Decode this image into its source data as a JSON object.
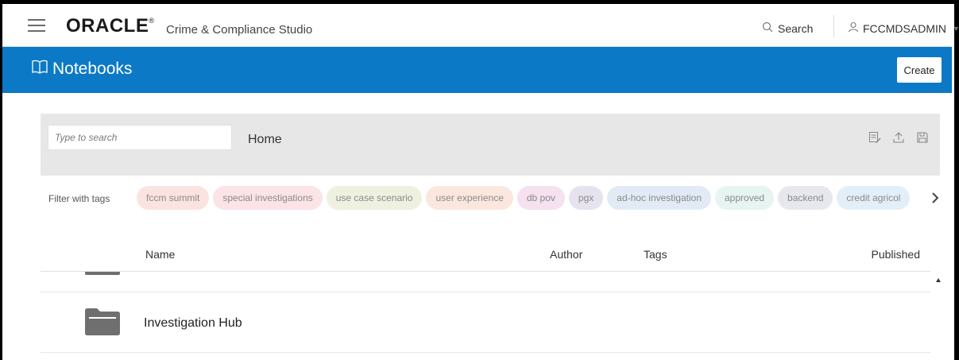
{
  "header": {
    "logo_text": "ORACLE",
    "logo_mark": "®",
    "app_name": "Crime & Compliance Studio",
    "search_label": "Search",
    "username": "FCCMDSADMIN"
  },
  "page": {
    "title": "Notebooks",
    "create_label": "Create"
  },
  "toolbar": {
    "search_placeholder": "Type to search",
    "breadcrumb": "Home"
  },
  "tags": {
    "label": "Filter with tags",
    "items": [
      {
        "label": "fccm summit",
        "color": "#fbe3df"
      },
      {
        "label": "special investigations",
        "color": "#fbe3e6"
      },
      {
        "label": "use case scenario",
        "color": "#eef1df"
      },
      {
        "label": "user experience",
        "color": "#fbe7dd"
      },
      {
        "label": "db pov",
        "color": "#f5e1ef"
      },
      {
        "label": "pgx",
        "color": "#e6e3ef"
      },
      {
        "label": "ad-hoc investigation",
        "color": "#e2ebf5"
      },
      {
        "label": "approved",
        "color": "#e6f4f2"
      },
      {
        "label": "backend",
        "color": "#e6e8ee"
      },
      {
        "label": "credit agricol",
        "color": "#e3eff8"
      }
    ]
  },
  "table": {
    "columns": {
      "name": "Name",
      "author": "Author",
      "tags": "Tags",
      "published": "Published"
    },
    "rows": [
      {
        "name": "Investigation Hub",
        "type": "folder"
      }
    ]
  },
  "colors": {
    "brand_blue": "#0c79c6",
    "folder_grey": "#6f6f6f"
  },
  "icons": [
    "menu-icon",
    "search-icon",
    "user-icon",
    "book-icon",
    "edit-notes-icon",
    "upload-icon",
    "save-icon",
    "chevron-right-icon",
    "folder-icon"
  ]
}
